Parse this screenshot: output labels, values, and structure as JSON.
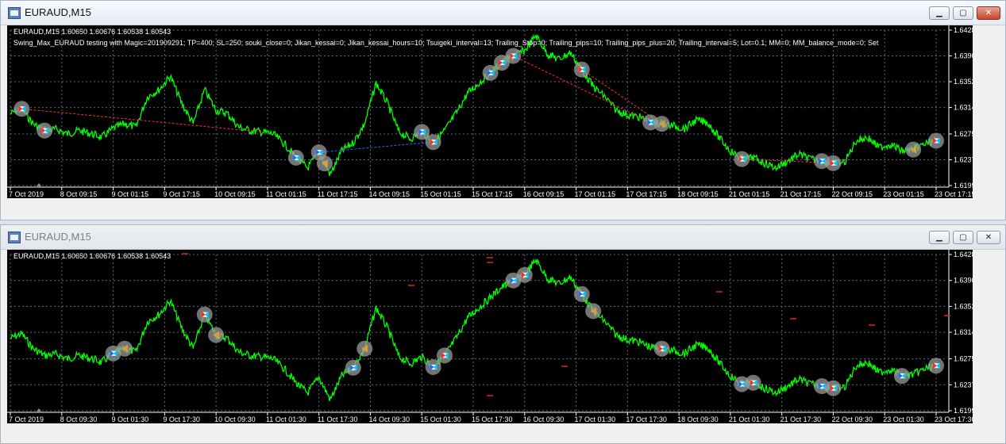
{
  "windows": [
    {
      "title": "EURAUD,M15",
      "info_line1": "EURAUD,M15  1.60650 1.60676 1.60538 1.60543",
      "info_line2": "Swing_Max_EURAUD testing with Magic=201909291; TP=400; SL=250; souki_close=0; Jikan_kessai=0; Jikan_kessai_hours=10; Tsuigeki_interval=13; Trailing_Stop=0; Trailing_pips=10; Trailing_pips_plus=20; Trailing_interval=5; Lot=0.1; MM=0; MM_balance_mode=0; Set",
      "time_labels": [
        "7 Oct 2019",
        "8 Oct 09:15",
        "9 Oct 01:15",
        "9 Oct 17:15",
        "10 Oct 09:15",
        "11 Oct 01:15",
        "11 Oct 17:15",
        "14 Oct 09:15",
        "15 Oct 01:15",
        "15 Oct 17:15",
        "16 Oct 09:15",
        "17 Oct 01:15",
        "17 Oct 17:15",
        "18 Oct 09:15",
        "21 Oct 01:15",
        "21 Oct 17:15",
        "22 Oct 09:15",
        "23 Oct 01:15",
        "23 Oct 17:15"
      ],
      "price_labels": [
        "1.64280",
        "1.63900",
        "1.63520",
        "1.63140",
        "1.62750",
        "1.62370",
        "1.61990"
      ]
    },
    {
      "title": "EURAUD,M15",
      "info_line1": "EURAUD,M15  1.60650 1.60676 1.60538 1.60543",
      "time_labels": [
        "7 Oct 2019",
        "8 Oct 09:30",
        "9 Oct 01:30",
        "9 Oct 17:30",
        "10 Oct 09:30",
        "11 Oct 01:30",
        "11 Oct 17:30",
        "14 Oct 09:30",
        "15 Oct 01:30",
        "15 Oct 17:30",
        "16 Oct 09:30",
        "17 Oct 01:30",
        "17 Oct 17:30",
        "18 Oct 09:30",
        "21 Oct 01:30",
        "21 Oct 17:30",
        "22 Oct 09:30",
        "23 Oct 01:30",
        "23 Oct 17:30"
      ],
      "price_labels": [
        "1.64280",
        "1.63900",
        "1.63520",
        "1.63140",
        "1.62750",
        "1.62370",
        "1.61990"
      ]
    }
  ],
  "chart_data": {
    "type": "line",
    "symbol": "EURAUD",
    "timeframe": "M15",
    "ylim": [
      1.6199,
      1.6428
    ],
    "grid": true,
    "series": [
      {
        "values": [
          1.6305,
          1.6312,
          1.629,
          1.628,
          1.6282,
          1.6275,
          1.628,
          1.6276,
          1.627,
          1.6283,
          1.629,
          1.6285,
          1.633,
          1.634,
          1.636,
          1.632,
          1.629,
          1.634,
          1.631,
          1.6305,
          1.6285,
          1.628,
          1.6278,
          1.6275,
          1.626,
          1.624,
          1.6225,
          1.6248,
          1.6215,
          1.625,
          1.6262,
          1.629,
          1.635,
          1.632,
          1.6278,
          1.6268,
          1.6278,
          1.6263,
          1.628,
          1.6305,
          1.6335,
          1.635,
          1.6365,
          1.638,
          1.639,
          1.6398,
          1.642,
          1.6393,
          1.6385,
          1.6395,
          1.637,
          1.6345,
          1.633,
          1.631,
          1.6303,
          1.63,
          1.6292,
          1.629,
          1.6287,
          1.6283,
          1.6295,
          1.6292,
          1.627,
          1.625,
          1.6238,
          1.624,
          1.6232,
          1.6225,
          1.6235,
          1.6245,
          1.6238,
          1.6235,
          1.6232,
          1.6233,
          1.6265,
          1.627,
          1.6255,
          1.626,
          1.625,
          1.6252,
          1.626,
          1.6265
        ]
      }
    ]
  },
  "colors": {
    "background": "#000000",
    "price_line": "#00ff00",
    "grid": "#5a6b7c",
    "entry_buy": "#1a6cff",
    "entry_sell": "#ff2a2a",
    "exit_marker": "#d5a040",
    "marker_halo": "#9a9a9a"
  },
  "markers_top": [
    {
      "i": 1,
      "k": "sell"
    },
    {
      "i": 3,
      "k": "sell"
    },
    {
      "i": 25,
      "k": "buy"
    },
    {
      "i": 27,
      "k": "buy"
    },
    {
      "i": 27.5,
      "k": "exit"
    },
    {
      "i": 36,
      "k": "buy"
    },
    {
      "i": 37,
      "k": "sell"
    },
    {
      "i": 43,
      "k": "sell"
    },
    {
      "i": 44,
      "k": "sell"
    },
    {
      "i": 42,
      "k": "buy"
    },
    {
      "i": 50,
      "k": "sell"
    },
    {
      "i": 56,
      "k": "buy"
    },
    {
      "i": 57,
      "k": "exit"
    },
    {
      "i": 64,
      "k": "sell"
    },
    {
      "i": 71,
      "k": "buy"
    },
    {
      "i": 72,
      "k": "sell"
    },
    {
      "i": 79,
      "k": "exit"
    },
    {
      "i": 86,
      "k": "sell"
    }
  ],
  "markers_bottom": [
    {
      "i": 9,
      "k": "buy"
    },
    {
      "i": 10,
      "k": "exit"
    },
    {
      "i": 17,
      "k": "sell"
    },
    {
      "i": 18,
      "k": "exit"
    },
    {
      "i": 30,
      "k": "buy"
    },
    {
      "i": 31,
      "k": "exit"
    },
    {
      "i": 37,
      "k": "buy"
    },
    {
      "i": 38,
      "k": "sell"
    },
    {
      "i": 44,
      "k": "buy"
    },
    {
      "i": 45,
      "k": "sell"
    },
    {
      "i": 50,
      "k": "buy"
    },
    {
      "i": 51,
      "k": "exit"
    },
    {
      "i": 57,
      "k": "sell"
    },
    {
      "i": 64,
      "k": "buy"
    },
    {
      "i": 65,
      "k": "sell"
    },
    {
      "i": 71,
      "k": "buy"
    },
    {
      "i": 72,
      "k": "sell"
    },
    {
      "i": 78,
      "k": "buy"
    },
    {
      "i": 86,
      "k": "sell"
    }
  ]
}
